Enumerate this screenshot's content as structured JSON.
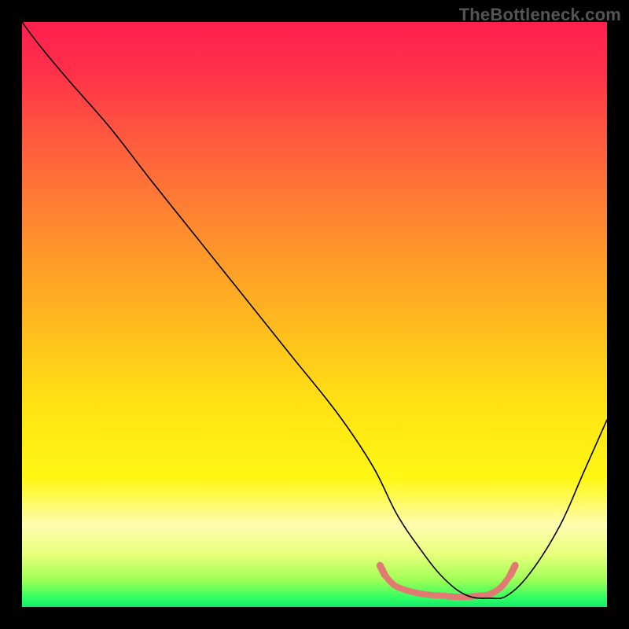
{
  "watermark": "TheBottleneck.com",
  "chart_data": {
    "type": "line",
    "title": "",
    "xlabel": "",
    "ylabel": "",
    "xlim": [
      0,
      100
    ],
    "ylim": [
      0,
      100
    ],
    "grid": false,
    "legend": false,
    "gradient_stops": [
      {
        "pos": 0.0,
        "color": "#ff1f4f"
      },
      {
        "pos": 0.08,
        "color": "#ff2f4a"
      },
      {
        "pos": 0.2,
        "color": "#ff5a3f"
      },
      {
        "pos": 0.35,
        "color": "#ff8a2f"
      },
      {
        "pos": 0.5,
        "color": "#ffb51f"
      },
      {
        "pos": 0.65,
        "color": "#ffe114"
      },
      {
        "pos": 0.78,
        "color": "#fff714"
      },
      {
        "pos": 0.86,
        "color": "#fffcb0"
      },
      {
        "pos": 0.91,
        "color": "#e8ff7a"
      },
      {
        "pos": 0.955,
        "color": "#9cff55"
      },
      {
        "pos": 0.985,
        "color": "#2eff64"
      },
      {
        "pos": 1.0,
        "color": "#14e86a"
      }
    ],
    "series": [
      {
        "name": "curve",
        "color": "#000000",
        "x": [
          0,
          3,
          8,
          15,
          22,
          30,
          38,
          46,
          54,
          60,
          64,
          68,
          72,
          76,
          80,
          83,
          87,
          92,
          96,
          100
        ],
        "y": [
          100,
          96,
          90,
          82,
          73,
          63,
          53,
          43,
          33,
          24,
          16,
          10,
          5,
          2,
          1.5,
          2,
          6,
          14,
          23,
          32
        ]
      }
    ],
    "highlight": {
      "name": "bottom-highlight",
      "color": "#e07a72",
      "x": [
        62,
        64,
        68,
        72,
        75,
        78,
        80,
        82,
        83.5
      ],
      "y": [
        5.5,
        3.5,
        2.3,
        1.9,
        1.7,
        1.9,
        2.2,
        3.5,
        5.5
      ]
    }
  }
}
